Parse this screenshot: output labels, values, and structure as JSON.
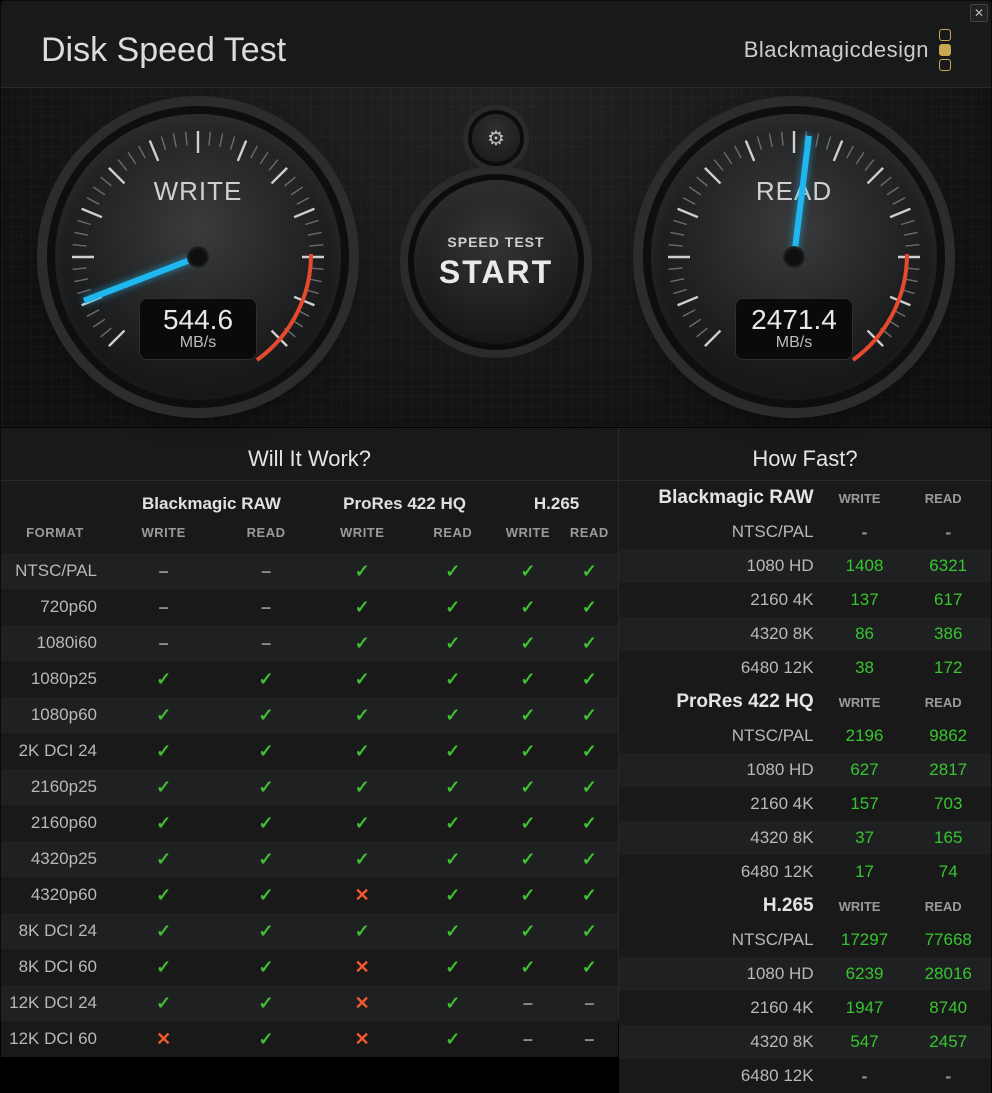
{
  "header": {
    "title": "Disk Speed Test",
    "brand": "Blackmagicdesign"
  },
  "gauges": {
    "write": {
      "label": "WRITE",
      "value": "544.6",
      "unit": "MB/s",
      "angle": 159,
      "max": 3000
    },
    "read": {
      "label": "READ",
      "value": "2471.4",
      "unit": "MB/s",
      "angle": 277,
      "max": 3000
    }
  },
  "center": {
    "settings_label": "Settings",
    "small": "SPEED TEST",
    "big": "START"
  },
  "will_it_work": {
    "title": "Will It Work?",
    "format_header": "FORMAT",
    "groups": [
      "Blackmagic RAW",
      "ProRes 422 HQ",
      "H.265"
    ],
    "cols": [
      "WRITE",
      "READ"
    ],
    "rows": [
      {
        "label": "NTSC/PAL",
        "cells": [
          "dash",
          "dash",
          "check",
          "check",
          "check",
          "check"
        ]
      },
      {
        "label": "720p60",
        "cells": [
          "dash",
          "dash",
          "check",
          "check",
          "check",
          "check"
        ]
      },
      {
        "label": "1080i60",
        "cells": [
          "dash",
          "dash",
          "check",
          "check",
          "check",
          "check"
        ]
      },
      {
        "label": "1080p25",
        "cells": [
          "check",
          "check",
          "check",
          "check",
          "check",
          "check"
        ]
      },
      {
        "label": "1080p60",
        "cells": [
          "check",
          "check",
          "check",
          "check",
          "check",
          "check"
        ]
      },
      {
        "label": "2K DCI 24",
        "cells": [
          "check",
          "check",
          "check",
          "check",
          "check",
          "check"
        ]
      },
      {
        "label": "2160p25",
        "cells": [
          "check",
          "check",
          "check",
          "check",
          "check",
          "check"
        ]
      },
      {
        "label": "2160p60",
        "cells": [
          "check",
          "check",
          "check",
          "check",
          "check",
          "check"
        ]
      },
      {
        "label": "4320p25",
        "cells": [
          "check",
          "check",
          "check",
          "check",
          "check",
          "check"
        ]
      },
      {
        "label": "4320p60",
        "cells": [
          "check",
          "check",
          "cross",
          "check",
          "check",
          "check"
        ]
      },
      {
        "label": "8K DCI 24",
        "cells": [
          "check",
          "check",
          "check",
          "check",
          "check",
          "check"
        ]
      },
      {
        "label": "8K DCI 60",
        "cells": [
          "check",
          "check",
          "cross",
          "check",
          "check",
          "check"
        ]
      },
      {
        "label": "12K DCI 24",
        "cells": [
          "check",
          "check",
          "cross",
          "check",
          "dash",
          "dash"
        ]
      },
      {
        "label": "12K DCI 60",
        "cells": [
          "cross",
          "check",
          "cross",
          "check",
          "dash",
          "dash"
        ]
      }
    ]
  },
  "how_fast": {
    "title": "How Fast?",
    "cols": [
      "WRITE",
      "READ"
    ],
    "sections": [
      {
        "name": "Blackmagic RAW",
        "rows": [
          {
            "label": "NTSC/PAL",
            "w": "-",
            "r": "-"
          },
          {
            "label": "1080 HD",
            "w": "1408",
            "r": "6321"
          },
          {
            "label": "2160 4K",
            "w": "137",
            "r": "617"
          },
          {
            "label": "4320 8K",
            "w": "86",
            "r": "386"
          },
          {
            "label": "6480 12K",
            "w": "38",
            "r": "172"
          }
        ]
      },
      {
        "name": "ProRes 422 HQ",
        "rows": [
          {
            "label": "NTSC/PAL",
            "w": "2196",
            "r": "9862"
          },
          {
            "label": "1080 HD",
            "w": "627",
            "r": "2817"
          },
          {
            "label": "2160 4K",
            "w": "157",
            "r": "703"
          },
          {
            "label": "4320 8K",
            "w": "37",
            "r": "165"
          },
          {
            "label": "6480 12K",
            "w": "17",
            "r": "74"
          }
        ]
      },
      {
        "name": "H.265",
        "rows": [
          {
            "label": "NTSC/PAL",
            "w": "17297",
            "r": "77668"
          },
          {
            "label": "1080 HD",
            "w": "6239",
            "r": "28016"
          },
          {
            "label": "2160 4K",
            "w": "1947",
            "r": "8740"
          },
          {
            "label": "4320 8K",
            "w": "547",
            "r": "2457"
          },
          {
            "label": "6480 12K",
            "w": "-",
            "r": "-"
          }
        ]
      }
    ]
  },
  "chart_data": {
    "gauges": [
      {
        "name": "WRITE",
        "value": 544.6,
        "unit": "MB/s"
      },
      {
        "name": "READ",
        "value": 2471.4,
        "unit": "MB/s"
      }
    ],
    "will_it_work": {
      "codecs": [
        "Blackmagic RAW",
        "ProRes 422 HQ",
        "H.265"
      ],
      "columns_per_codec": [
        "WRITE",
        "READ"
      ],
      "legend": {
        "check": "supported",
        "cross": "unsupported",
        "dash": "n/a"
      },
      "rows": [
        {
          "format": "NTSC/PAL",
          "values": [
            "dash",
            "dash",
            "check",
            "check",
            "check",
            "check"
          ]
        },
        {
          "format": "720p60",
          "values": [
            "dash",
            "dash",
            "check",
            "check",
            "check",
            "check"
          ]
        },
        {
          "format": "1080i60",
          "values": [
            "dash",
            "dash",
            "check",
            "check",
            "check",
            "check"
          ]
        },
        {
          "format": "1080p25",
          "values": [
            "check",
            "check",
            "check",
            "check",
            "check",
            "check"
          ]
        },
        {
          "format": "1080p60",
          "values": [
            "check",
            "check",
            "check",
            "check",
            "check",
            "check"
          ]
        },
        {
          "format": "2K DCI 24",
          "values": [
            "check",
            "check",
            "check",
            "check",
            "check",
            "check"
          ]
        },
        {
          "format": "2160p25",
          "values": [
            "check",
            "check",
            "check",
            "check",
            "check",
            "check"
          ]
        },
        {
          "format": "2160p60",
          "values": [
            "check",
            "check",
            "check",
            "check",
            "check",
            "check"
          ]
        },
        {
          "format": "4320p25",
          "values": [
            "check",
            "check",
            "check",
            "check",
            "check",
            "check"
          ]
        },
        {
          "format": "4320p60",
          "values": [
            "check",
            "check",
            "cross",
            "check",
            "check",
            "check"
          ]
        },
        {
          "format": "8K DCI 24",
          "values": [
            "check",
            "check",
            "check",
            "check",
            "check",
            "check"
          ]
        },
        {
          "format": "8K DCI 60",
          "values": [
            "check",
            "check",
            "cross",
            "check",
            "check",
            "check"
          ]
        },
        {
          "format": "12K DCI 24",
          "values": [
            "check",
            "check",
            "cross",
            "check",
            "dash",
            "dash"
          ]
        },
        {
          "format": "12K DCI 60",
          "values": [
            "cross",
            "check",
            "cross",
            "check",
            "dash",
            "dash"
          ]
        }
      ]
    },
    "how_fast_fps": [
      {
        "codec": "Blackmagic RAW",
        "rows": [
          {
            "format": "NTSC/PAL",
            "write": null,
            "read": null
          },
          {
            "format": "1080 HD",
            "write": 1408,
            "read": 6321
          },
          {
            "format": "2160 4K",
            "write": 137,
            "read": 617
          },
          {
            "format": "4320 8K",
            "write": 86,
            "read": 386
          },
          {
            "format": "6480 12K",
            "write": 38,
            "read": 172
          }
        ]
      },
      {
        "codec": "ProRes 422 HQ",
        "rows": [
          {
            "format": "NTSC/PAL",
            "write": 2196,
            "read": 9862
          },
          {
            "format": "1080 HD",
            "write": 627,
            "read": 2817
          },
          {
            "format": "2160 4K",
            "write": 157,
            "read": 703
          },
          {
            "format": "4320 8K",
            "write": 37,
            "read": 165
          },
          {
            "format": "6480 12K",
            "write": 17,
            "read": 74
          }
        ]
      },
      {
        "codec": "H.265",
        "rows": [
          {
            "format": "NTSC/PAL",
            "write": 17297,
            "read": 77668
          },
          {
            "format": "1080 HD",
            "write": 6239,
            "read": 28016
          },
          {
            "format": "2160 4K",
            "write": 1947,
            "read": 8740
          },
          {
            "format": "4320 8K",
            "write": 547,
            "read": 2457
          },
          {
            "format": "6480 12K",
            "write": null,
            "read": null
          }
        ]
      }
    ]
  }
}
